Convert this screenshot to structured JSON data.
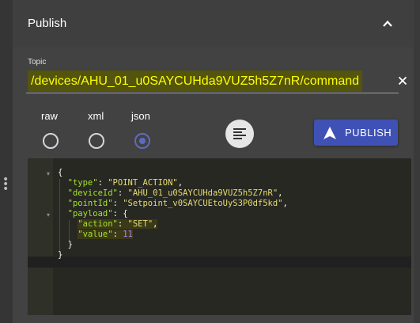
{
  "panel": {
    "title": "Publish",
    "topic_label": "Topic",
    "topic_value": "/devices/AHU_01_u0SAYCUHda9VUZ5h5Z7nR/command",
    "formats": [
      {
        "label": "raw",
        "selected": false
      },
      {
        "label": "xml",
        "selected": false
      },
      {
        "label": "json",
        "selected": true
      }
    ],
    "publish_label": "PUBLISH"
  },
  "editor": {
    "lines": [
      "{",
      "  \"type\": \"POINT_ACTION\",",
      "  \"deviceId\": \"AHU_01_u0SAYCUHda9VUZ5h5Z7nR\",",
      "  \"pointId\": \"Setpoint_v0SAYCUEtoUyS3P0df5kd\",",
      "  \"payload\": {",
      "    \"action\": \"SET\",",
      "    \"value\": 11",
      "  }",
      "}"
    ]
  },
  "colors": {
    "accent": "#3f51b5",
    "topic_text": "#ffff00",
    "topic_highlight": "#53540d",
    "editor_bg": "#272822"
  },
  "icons": [
    "chevron-up-icon",
    "close-icon",
    "format-align-icon",
    "send-icon",
    "drag-handle-icon",
    "fold-arrow-icon"
  ]
}
